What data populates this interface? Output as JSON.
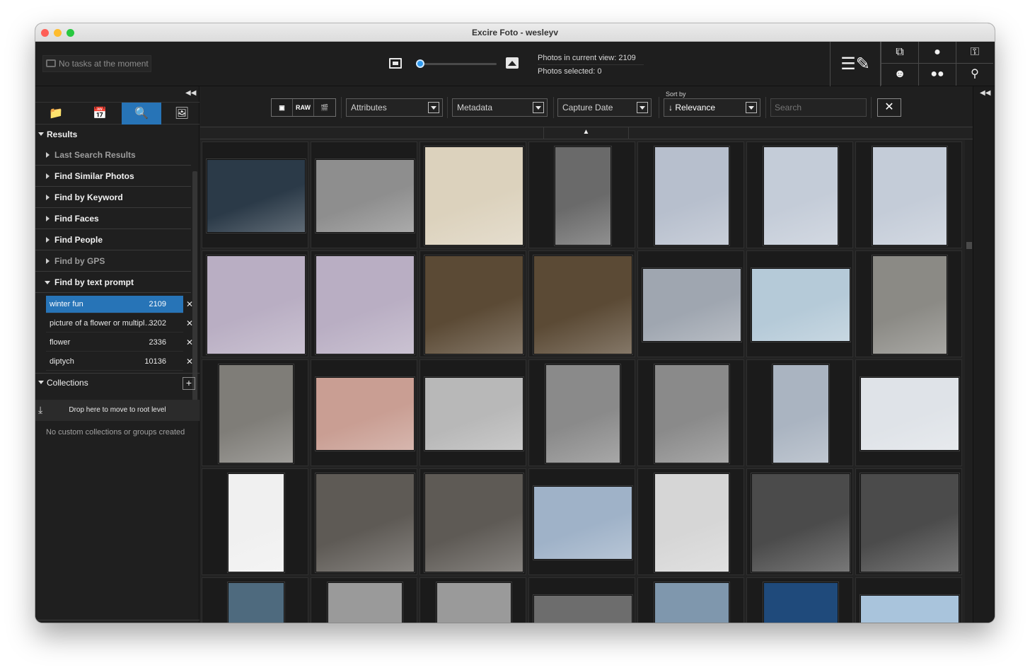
{
  "window": {
    "title": "Excire Foto - wesleyv"
  },
  "toolbar": {
    "tasks_label": "No tasks at the moment",
    "zoom_level": 0.0,
    "photos_in_view": "Photos in current view: 2109",
    "photos_selected": "Photos selected: 0",
    "right_buttons": [
      {
        "name": "edit-metadata",
        "icon": "edit-lines-icon"
      },
      {
        "name": "duplicates",
        "icon": "duplicates-icon"
      },
      {
        "name": "gps",
        "icon": "map-pin-icon"
      },
      {
        "name": "keys",
        "icon": "key-icon"
      },
      {
        "name": "faces",
        "icon": "face-icon"
      },
      {
        "name": "people",
        "icon": "people-icon"
      },
      {
        "name": "search",
        "icon": "search-icon"
      }
    ]
  },
  "sidebar": {
    "tabs": [
      {
        "icon": "folder-icon"
      },
      {
        "icon": "calendar-people-icon"
      },
      {
        "icon": "search-image-icon",
        "active": true
      },
      {
        "icon": "collections-icon"
      }
    ],
    "results_label": "Results",
    "items": [
      {
        "label": "Last Search Results",
        "dim": true
      },
      {
        "label": "Find Similar Photos"
      },
      {
        "label": "Find by Keyword"
      },
      {
        "label": "Find Faces"
      },
      {
        "label": "Find People"
      },
      {
        "label": "Find by GPS",
        "dim": true
      },
      {
        "label": "Find by text prompt",
        "expanded": true
      }
    ],
    "prompts": [
      {
        "text": "winter fun",
        "count": "2109",
        "active": true
      },
      {
        "text": "picture of a flower or multipl…",
        "count": "3202"
      },
      {
        "text": "flower",
        "count": "2336"
      },
      {
        "text": "diptych",
        "count": "10136"
      }
    ],
    "collections_label": "Collections",
    "drop_label": "Drop here to move to root level",
    "no_collections": "No custom collections or groups created"
  },
  "filters": {
    "type_buttons": [
      "image",
      "RAW",
      "video"
    ],
    "attributes": "Attributes",
    "metadata": "Metadata",
    "capture_date": "Capture Date",
    "sort_by_label": "Sort by",
    "sort_value": "Relevance",
    "search_placeholder": "Search"
  },
  "grid": {
    "rows": [
      [
        {
          "bg": "#2b3a48",
          "aspect": "landscape",
          "name": "night-rink"
        },
        {
          "bg": "#8e8e8e",
          "aspect": "landscape",
          "name": "bw-portrait-snow"
        },
        {
          "bg": "#dcd2bd",
          "aspect": "square",
          "name": "snow-angel"
        },
        {
          "bg": "#6a6a6a",
          "aspect": "portrait-narrow",
          "name": "truck-snow-caption"
        },
        {
          "bg": "#b7bfcd",
          "aspect": "portrait",
          "name": "kid-sled-dog"
        },
        {
          "bg": "#c4ccd8",
          "aspect": "portrait",
          "name": "dog-trees-snow"
        },
        {
          "bg": "#c4ccd8",
          "aspect": "portrait",
          "name": "dog-trees-snow-2"
        }
      ],
      [
        {
          "bg": "#b9aec3",
          "aspect": "square",
          "name": "walker-field"
        },
        {
          "bg": "#b9aec3",
          "aspect": "square",
          "name": "walker-field-2"
        },
        {
          "bg": "#5b4a35",
          "aspect": "square",
          "name": "woman-hat-toned"
        },
        {
          "bg": "#5b4a35",
          "aspect": "square",
          "name": "woman-hat-toned-2"
        },
        {
          "bg": "#9fa6b0",
          "aspect": "landscape",
          "name": "family-sled"
        },
        {
          "bg": "#b5cad8",
          "aspect": "landscape",
          "name": "bike-snow"
        },
        {
          "bg": "#8b8a85",
          "aspect": "portrait",
          "name": "man-woods"
        }
      ],
      [
        {
          "bg": "#7f7d78",
          "aspect": "portrait",
          "name": "man-woods-2"
        },
        {
          "bg": "#c99e93",
          "aspect": "landscape",
          "name": "park-bikes"
        },
        {
          "bg": "#b8b8b8",
          "aspect": "landscape",
          "name": "bw-woman-snow"
        },
        {
          "bg": "#8a8a8a",
          "aspect": "portrait",
          "name": "bw-parent-child"
        },
        {
          "bg": "#8a8a8a",
          "aspect": "portrait",
          "name": "bw-parent-child-2"
        },
        {
          "bg": "#aab4c1",
          "aspect": "portrait-narrow",
          "name": "ski-resort"
        },
        {
          "bg": "#dfe3e8",
          "aspect": "landscape",
          "name": "dog-snow-field"
        }
      ],
      [
        {
          "bg": "#f0f0f0",
          "aspect": "portrait-narrow",
          "name": "diptych-sledding"
        },
        {
          "bg": "#5e5a55",
          "aspect": "square",
          "name": "frosty-beard"
        },
        {
          "bg": "#5e5a55",
          "aspect": "square",
          "name": "frosty-beard-2"
        },
        {
          "bg": "#9fb2c8",
          "aspect": "landscape",
          "name": "snowy-lake"
        },
        {
          "bg": "#d6d6d6",
          "aspect": "portrait",
          "name": "runner-shore"
        },
        {
          "bg": "#4b4b4b",
          "aspect": "square",
          "name": "stadium-lights"
        },
        {
          "bg": "#4b4b4b",
          "aspect": "square",
          "name": "stadium-lights-2"
        }
      ],
      [
        {
          "bg": "#4e6a7e",
          "aspect": "portrait-narrow",
          "name": "mountain-forest"
        },
        {
          "bg": "#9a9a9a",
          "aspect": "portrait",
          "name": "bw-trees"
        },
        {
          "bg": "#9a9a9a",
          "aspect": "portrait",
          "name": "bw-trees-2"
        },
        {
          "bg": "#6d6d6d",
          "aspect": "landscape",
          "name": "bw-sky"
        },
        {
          "bg": "#7f97ad",
          "aspect": "portrait",
          "name": "snowy-pines"
        },
        {
          "bg": "#1f4a7b",
          "aspect": "portrait",
          "name": "blue-dusk"
        },
        {
          "bg": "#a9c4dc",
          "aspect": "landscape",
          "name": "sunlit-trees"
        }
      ]
    ]
  }
}
